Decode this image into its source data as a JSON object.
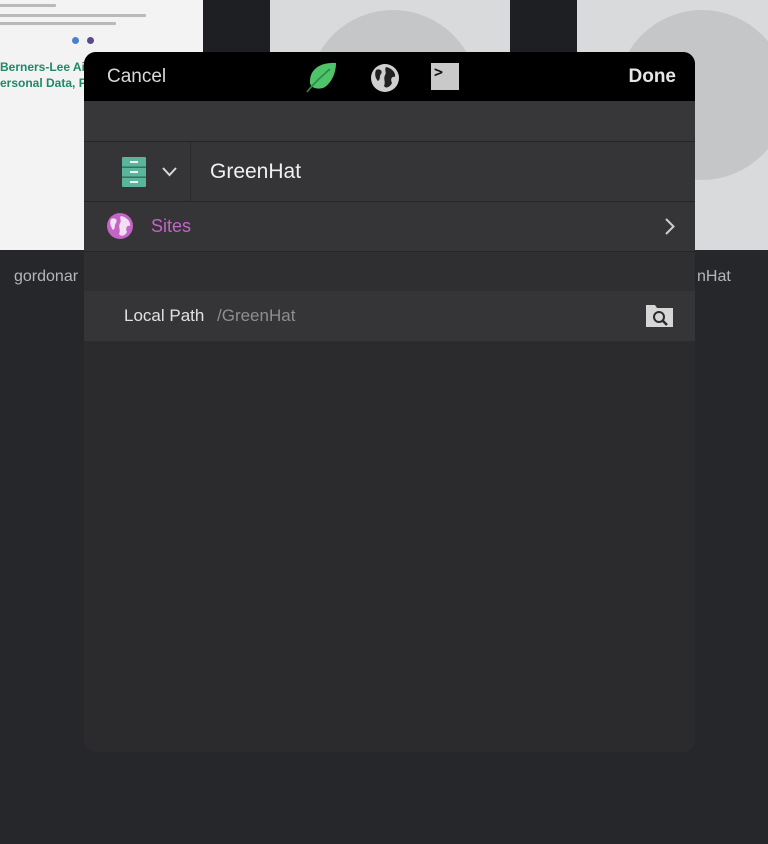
{
  "background": {
    "doc_heading_1": "Berners-Lee Aims to Gi",
    "doc_heading_2": "ersonal Data, Possibly",
    "thumb_labels": [
      "gordonar",
      "nHat"
    ]
  },
  "modal": {
    "cancel_label": "Cancel",
    "done_label": "Done",
    "header_icons": [
      "leaf-icon",
      "globe-icon",
      "terminal-icon"
    ],
    "name_value": "GreenHat",
    "sites_label": "Sites",
    "local_path_label": "Local Path",
    "local_path_value": "/GreenHat"
  },
  "colors": {
    "accent_green": "#4ec36a",
    "sites_purple": "#c464c6",
    "cabinet_teal": "#5ab59b"
  }
}
